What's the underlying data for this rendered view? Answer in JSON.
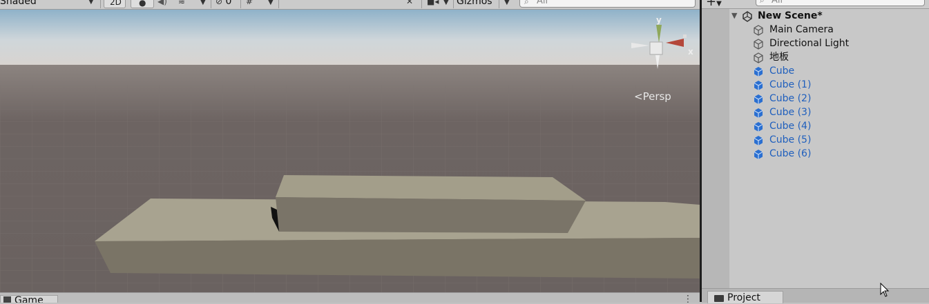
{
  "scene_toolbar": {
    "shading_mode": "Shaded",
    "two_d_label": "2D",
    "hidden_count": "0",
    "gizmos_label": "Gizmos",
    "search_placeholder": "All"
  },
  "scene_view": {
    "projection_label": "Persp",
    "axis_y": "y",
    "axis_x": "x"
  },
  "bottom_tabs": {
    "game_tab_label": "Game"
  },
  "hierarchy": {
    "search_placeholder": "All",
    "scene_name": "New Scene*",
    "items": [
      {
        "label": "Main Camera",
        "type": "grey"
      },
      {
        "label": "Directional Light",
        "type": "grey"
      },
      {
        "label": "地板",
        "type": "grey"
      },
      {
        "label": "Cube",
        "type": "blue"
      },
      {
        "label": "Cube (1)",
        "type": "blue"
      },
      {
        "label": "Cube (2)",
        "type": "blue"
      },
      {
        "label": "Cube (3)",
        "type": "blue"
      },
      {
        "label": "Cube (4)",
        "type": "blue"
      },
      {
        "label": "Cube (5)",
        "type": "blue"
      },
      {
        "label": "Cube (6)",
        "type": "blue"
      }
    ]
  },
  "project_tab": {
    "label": "Project"
  },
  "colors": {
    "prefab_blue": "#1f5fbd",
    "scene_background": "#6a6260",
    "cube_face": "#a39e8a"
  }
}
